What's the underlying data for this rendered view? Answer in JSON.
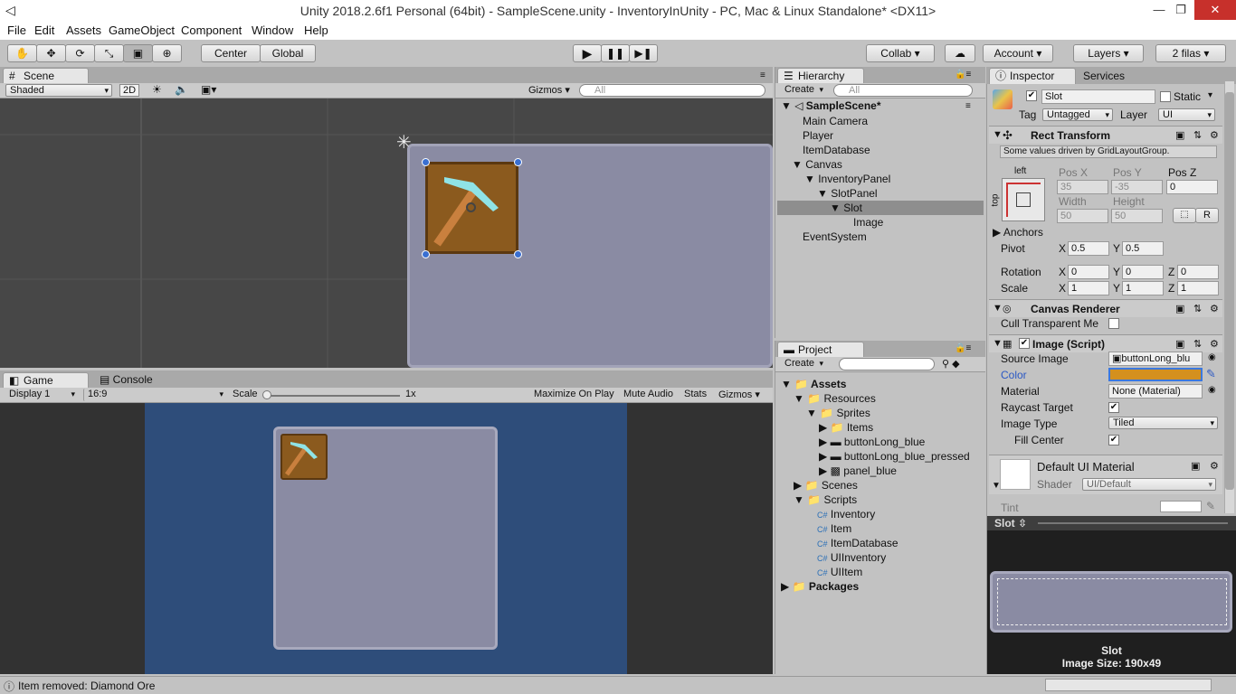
{
  "window": {
    "title": "Unity 2018.2.6f1 Personal (64bit) - SampleScene.unity - InventoryInUnity - PC, Mac & Linux Standalone* <DX11>"
  },
  "menu": [
    "File",
    "Edit",
    "Assets",
    "GameObject",
    "Component",
    "Window",
    "Help"
  ],
  "toolbar": {
    "center": "Center",
    "global": "Global",
    "collab": "Collab",
    "account": "Account",
    "layers": "Layers",
    "layout": "2 filas"
  },
  "scene": {
    "tab": "Scene",
    "shading": "Shaded",
    "mode2d": "2D",
    "gizmos": "Gizmos",
    "search_placeholder": "All"
  },
  "game": {
    "tab": "Game",
    "console_tab": "Console",
    "display": "Display 1",
    "aspect": "16:9",
    "scale_label": "Scale",
    "scale_value": "1x",
    "maximize": "Maximize On Play",
    "mute": "Mute Audio",
    "stats": "Stats",
    "gizmos": "Gizmos"
  },
  "hierarchy": {
    "tab": "Hierarchy",
    "create": "Create",
    "search_placeholder": "All",
    "scene": "SampleScene*",
    "items": [
      "Main Camera",
      "Player",
      "ItemDatabase",
      "Canvas",
      "InventoryPanel",
      "SlotPanel",
      "Slot",
      "Image",
      "EventSystem"
    ]
  },
  "project": {
    "tab": "Project",
    "create": "Create",
    "items": [
      "Assets",
      "Resources",
      "Sprites",
      "Items",
      "buttonLong_blue",
      "buttonLong_blue_pressed",
      "panel_blue",
      "Scenes",
      "Scripts",
      "Inventory",
      "Item",
      "ItemDatabase",
      "UIInventory",
      "UIItem",
      "Packages"
    ]
  },
  "inspector": {
    "tab": "Inspector",
    "services_tab": "Services",
    "name": "Slot",
    "static": "Static",
    "tag_label": "Tag",
    "tag": "Untagged",
    "layer_label": "Layer",
    "layer": "UI",
    "rect": {
      "title": "Rect Transform",
      "note": "Some values driven by GridLayoutGroup.",
      "anchor_h": "left",
      "anchor_v": "top",
      "posx_l": "Pos X",
      "posy_l": "Pos Y",
      "posz_l": "Pos Z",
      "posx": "35",
      "posy": "-35",
      "posz": "0",
      "width_l": "Width",
      "height_l": "Height",
      "width": "50",
      "height": "50",
      "r": "R",
      "anchors": "Anchors",
      "pivot": "Pivot",
      "pivot_x": "0.5",
      "pivot_y": "0.5",
      "rotation": "Rotation",
      "rot_x": "0",
      "rot_y": "0",
      "rot_z": "0",
      "scale": "Scale",
      "sc_x": "1",
      "sc_y": "1",
      "sc_z": "1",
      "x": "X",
      "y": "Y",
      "z": "Z"
    },
    "canvas_renderer": {
      "title": "Canvas Renderer",
      "cull": "Cull Transparent Me"
    },
    "image": {
      "title": "Image (Script)",
      "source_l": "Source Image",
      "source": "buttonLong_blu",
      "color_l": "Color",
      "color": "#d4901e",
      "material_l": "Material",
      "material": "None (Material)",
      "raycast_l": "Raycast Target",
      "type_l": "Image Type",
      "type": "Tiled",
      "fill_l": "Fill Center"
    },
    "material": {
      "title": "Default UI Material",
      "shader_l": "Shader",
      "shader": "UI/Default",
      "tint": "Tint"
    },
    "preview": {
      "tab": "Slot",
      "name": "Slot",
      "size": "Image Size: 190x49"
    }
  },
  "status": {
    "message": "Item removed: Diamond Ore"
  },
  "colors": {
    "panel_blue": "#2e4d7a",
    "slot_brown": "#8b5a1e",
    "panel_gray": "#8c8ca4"
  }
}
